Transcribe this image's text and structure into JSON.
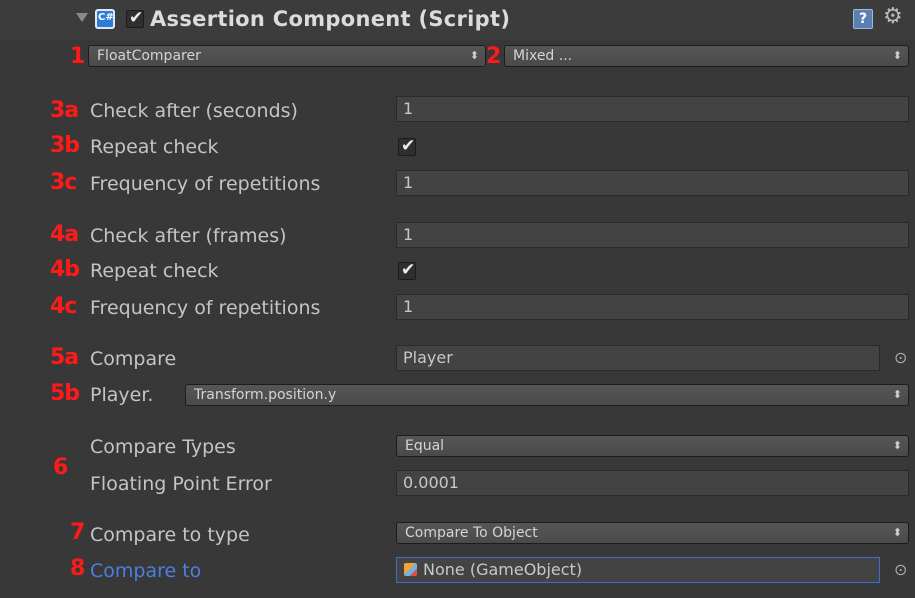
{
  "header": {
    "title": "Assertion Component (Script)",
    "enabled": true,
    "help_glyph": "?",
    "gear_glyph": "⚙"
  },
  "markers": {
    "m1": "1",
    "m2": "2",
    "m3a": "3a",
    "m3b": "3b",
    "m3c": "3c",
    "m4a": "4a",
    "m4b": "4b",
    "m4c": "4c",
    "m5a": "5a",
    "m5b": "5b",
    "m6": "6",
    "m7": "7",
    "m8": "8"
  },
  "comparer": {
    "value": "FloatComparer"
  },
  "check_methods": {
    "value": "Mixed ..."
  },
  "seconds": {
    "check_after_label": "Check after (seconds)",
    "check_after_value": "1",
    "repeat_label": "Repeat check",
    "repeat_checked": true,
    "frequency_label": "Frequency of repetitions",
    "frequency_value": "1"
  },
  "frames": {
    "check_after_label": "Check after (frames)",
    "check_after_value": "1",
    "repeat_label": "Repeat check",
    "repeat_checked": true,
    "frequency_label": "Frequency of repetitions",
    "frequency_value": "1"
  },
  "compare": {
    "label": "Compare",
    "value": "Player",
    "path_label": "Player.",
    "path_value": "Transform.position.y",
    "types_label": "Compare Types",
    "types_value": "Equal",
    "fp_error_label": "Floating Point Error",
    "fp_error_value": "0.0001",
    "to_type_label": "Compare to type",
    "to_type_value": "Compare To Object",
    "to_label": "Compare to",
    "to_value": "None (GameObject)"
  },
  "icons": {
    "foldout": "foldout-triangle-icon",
    "script": "csharp-script-icon",
    "help": "help-icon",
    "gear": "gear-icon",
    "object_picker": "object-picker-icon",
    "gameobject": "gameobject-cube-icon"
  },
  "colors": {
    "marker": "#ff1a1a",
    "compare_to_label": "#4a7fe0",
    "focus_border": "#3c6ecf",
    "background": "#383838"
  }
}
